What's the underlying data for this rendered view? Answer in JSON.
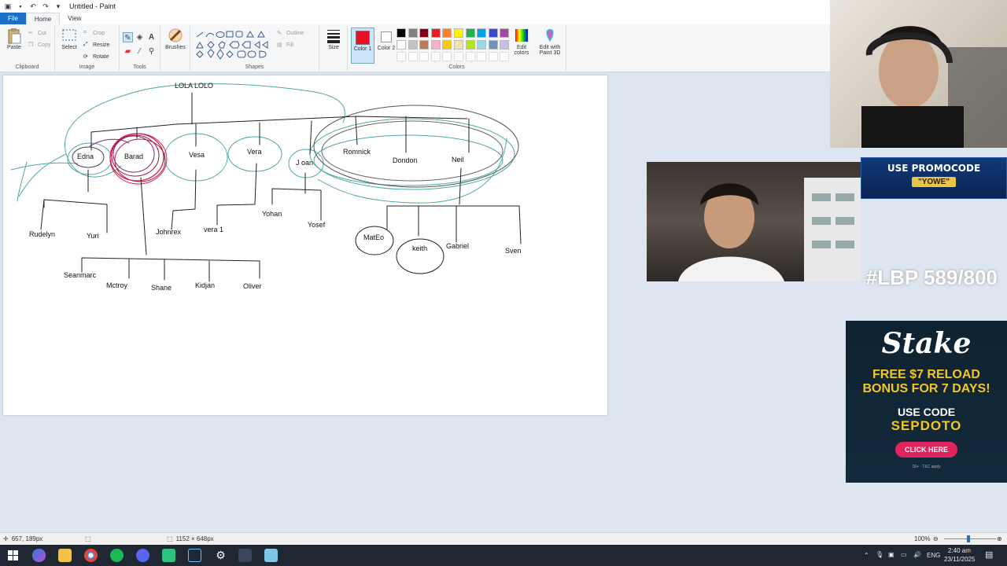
{
  "window": {
    "title": "Untitled - Paint"
  },
  "tabs": [
    "File",
    "Home",
    "View"
  ],
  "ribbon": {
    "clipboard": {
      "label": "Clipboard",
      "paste": "Paste",
      "cut": "Cut",
      "copy": "Copy"
    },
    "image": {
      "label": "Image",
      "select": "Select",
      "crop": "Crop",
      "resize": "Resize",
      "rotate": "Rotate"
    },
    "tools": {
      "label": "Tools"
    },
    "brushes": {
      "label": "Brushes"
    },
    "shapes": {
      "label": "Shapes",
      "outline": "Outline",
      "fill": "Fill"
    },
    "size": {
      "label": "Size"
    },
    "colors": {
      "label": "Colors",
      "color1": "Color 1",
      "color2": "Color 2",
      "edit": "Edit colors",
      "paint3d": "Edit with Paint 3D",
      "color1_value": "#e81123",
      "color2_value": "#ffffff",
      "palette_row1": [
        "#000000",
        "#7f7f7f",
        "#880015",
        "#ed1c24",
        "#ff7f27",
        "#fff200",
        "#22b14c",
        "#00a2e8",
        "#3f48cc",
        "#a349a4"
      ],
      "palette_row2": [
        "#ffffff",
        "#c3c3c3",
        "#b97a57",
        "#ffaec9",
        "#ffc90e",
        "#efe4b0",
        "#b5e61d",
        "#99d9ea",
        "#7092be",
        "#c8bfe7"
      ]
    }
  },
  "drawing": {
    "labels": [
      "LOLA LOLO",
      "Edna",
      "Barad",
      "Vesa",
      "Vera",
      "J oan",
      "Romnick",
      "Dondon",
      "Neil",
      "Rudelyn",
      "Yuri",
      "Johnrex",
      "vera 1",
      "Yohan",
      "Yosef",
      "MatEo",
      "keith",
      "Gabriel",
      "Sven",
      "Seanmarc",
      "Mctroy",
      "Shane",
      "Kidjan",
      "Oliver"
    ]
  },
  "status": {
    "cursor": "657, 189px",
    "canvas_size": "1152 × 648px",
    "zoom": "100%"
  },
  "taskbar": {
    "lang": "ENG",
    "time": "2:40 am",
    "date": "23/11/2025"
  },
  "overlays": {
    "promo_line1": "USE PROMOCODE",
    "promo_code": "\"YOWE\"",
    "counter": "#LBP 589/800",
    "stake_logo": "Stake",
    "stake_line1": "FREE $7 RELOAD",
    "stake_line2": "BONUS FOR 7 DAYS!",
    "stake_line3": "USE CODE",
    "stake_code": "SEPDOTO",
    "stake_cta": "CLICK HERE",
    "stake_fine": "18+ · T&C apply"
  }
}
